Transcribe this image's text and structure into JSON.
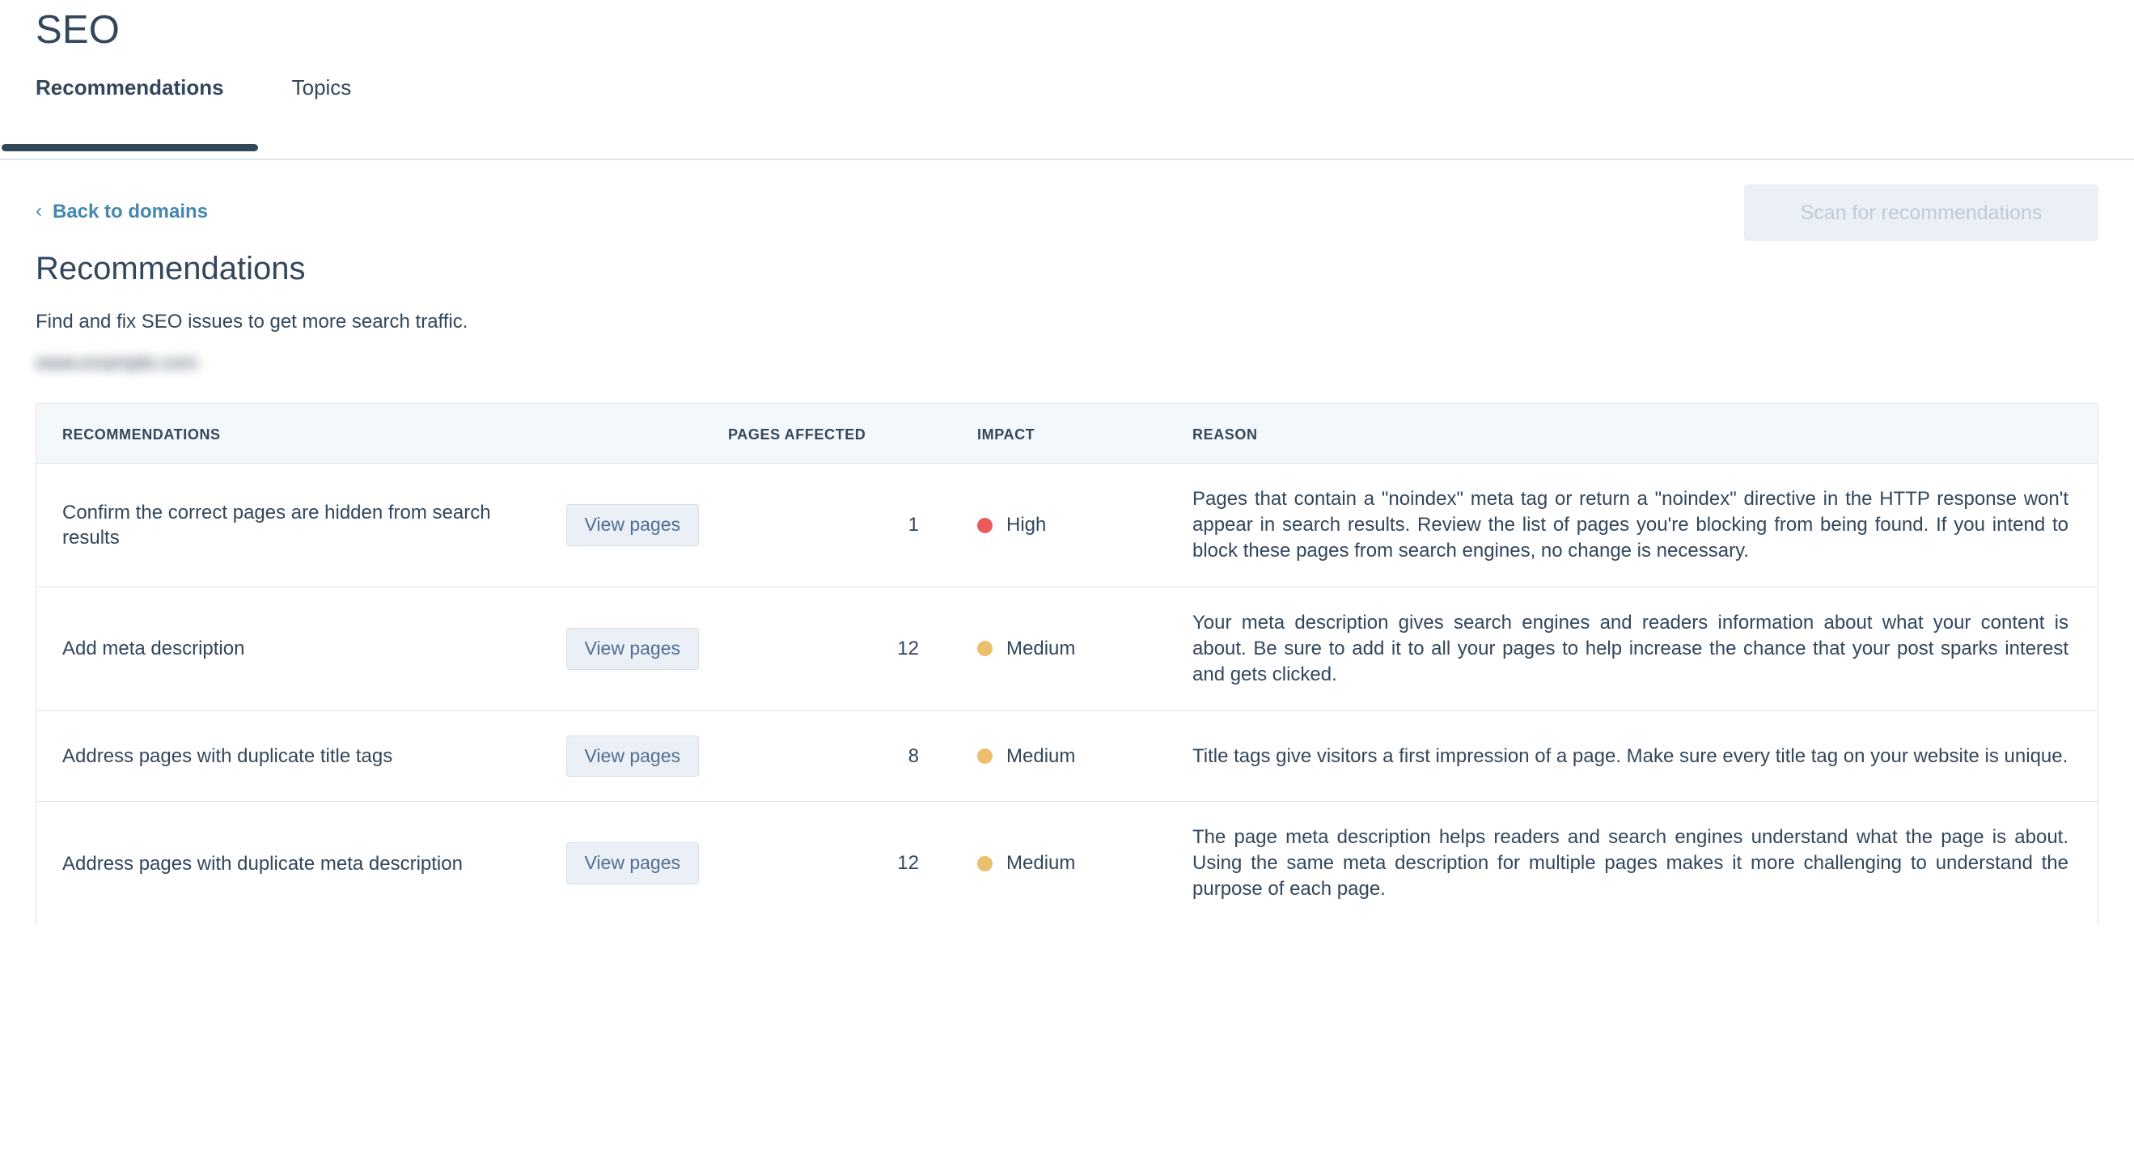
{
  "app": {
    "title": "SEO"
  },
  "tabs": [
    {
      "label": "Recommendations",
      "active": true
    },
    {
      "label": "Topics",
      "active": false
    }
  ],
  "breadcrumb": {
    "back_label": "Back to domains",
    "chevron": "‹",
    "color": "#4688ad"
  },
  "page": {
    "title": "Recommendations",
    "description": "Find and fix SEO issues to get more search traffic.",
    "domain": "www.example.com"
  },
  "actions": {
    "scan_label": "Scan for recommendations",
    "scan_disabled": true
  },
  "table": {
    "columns": [
      "RECOMMENDATIONS",
      "PAGES AFFECTED",
      "IMPACT",
      "REASON"
    ],
    "view_pages_label": "View pages",
    "rows": [
      {
        "recommendation": "Confirm the correct pages are hidden from search results",
        "pages_affected": "1",
        "impact": "High",
        "impact_color": "#ea5b5b",
        "reason": "Pages that contain a \"noindex\" meta tag or return a \"noindex\" directive in the HTTP response won't appear in search results. Review the list of pages you're blocking from being found. If you intend to block these pages from search engines, no change is necessary."
      },
      {
        "recommendation": "Add meta description",
        "pages_affected": "12",
        "impact": "Medium",
        "impact_color": "#eabf6e",
        "reason": "Your meta description gives search engines and readers information about what your content is about. Be sure to add it to all your pages to help increase the chance that your post sparks interest and gets clicked."
      },
      {
        "recommendation": "Address pages with duplicate title tags",
        "pages_affected": "8",
        "impact": "Medium",
        "impact_color": "#eabf6e",
        "reason": "Title tags give visitors a first impression of a page. Make sure every title tag on your website is unique."
      },
      {
        "recommendation": "Address pages with duplicate meta description",
        "pages_affected": "12",
        "impact": "Medium",
        "impact_color": "#eabf6e",
        "reason": "The page meta description helps readers and search engines understand what the page is about. Using the same meta description for multiple pages makes it more challenging to understand the purpose of each page."
      }
    ]
  },
  "theme": {
    "text": "#33475b",
    "link": "#4688ad",
    "border": "#dfe3eb",
    "header_bg": "#f5f8fa",
    "button_bg": "#eaf0f6",
    "button_text": "#506e91",
    "disabled_text": "#bfcbd9"
  }
}
